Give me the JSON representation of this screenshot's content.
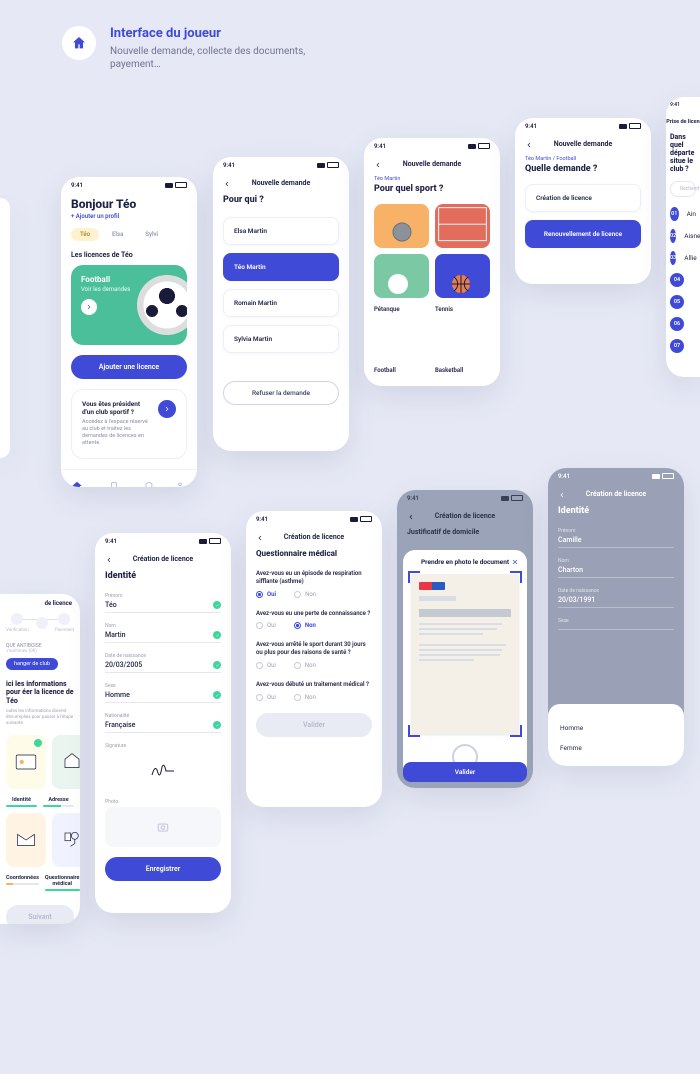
{
  "header": {
    "title": "Interface du joueur",
    "subtitle": "Nouvelle demande, collecte des documents, payement…"
  },
  "status_time": "9:41",
  "p1_home": {
    "greeting": "Bonjour Téo",
    "add_profile": "+ Ajouter un profil",
    "tabs": [
      "Téo",
      "Elsa",
      "Sylvi"
    ],
    "section": "Les licences de Téo",
    "card_sport": "Football",
    "card_view": "Voir les demandes",
    "cta": "Ajouter une licence",
    "president_title": "Vous êtes président d'un club sportif ?",
    "president_body": "Accédez à l'espace réservé au club et traitez les demandes de licences en attente.",
    "nav": [
      "Accueil",
      "Documents",
      "Club",
      "Compte"
    ]
  },
  "p2_who": {
    "title": "Nouvelle demande",
    "q": "Pour qui ?",
    "names": [
      "Elsa Martin",
      "Téo Martin",
      "Romain Martin",
      "Sylvia Martin"
    ],
    "refuse": "Refuser la demande"
  },
  "p3_sport": {
    "title": "Nouvelle demande",
    "crumb": "Téo Martin",
    "q": "Pour quel sport ?",
    "sports": [
      "Pétanque",
      "Tennis",
      "Football",
      "Basketball"
    ]
  },
  "p4_type": {
    "title": "Nouvelle demande",
    "crumb": "Téo Martin / Football",
    "q": "Quelle demande ?",
    "opt1": "Création de licence",
    "opt2": "Renouvellement de licence"
  },
  "p5_dep": {
    "title": "Prise de licen",
    "q": "Dans quel départe\nsitue le club ?",
    "search": "Rechercher",
    "deps": [
      {
        "n": "01",
        "name": "Ain"
      },
      {
        "n": "02",
        "name": "Aisne"
      },
      {
        "n": "03",
        "name": "Allie"
      },
      {
        "n": "04",
        "name": ""
      },
      {
        "n": "05",
        "name": ""
      },
      {
        "n": "06",
        "name": ""
      },
      {
        "n": "07",
        "name": ""
      }
    ]
  },
  "p6_lic": {
    "title": "de licence",
    "stepper": [
      "Vérification",
      "",
      "Paiement"
    ],
    "club": "QUE ANTIBOISE",
    "club2": "-maritimes (06)",
    "change": "hanger de club",
    "headline": "ici les informations pour éer la licence de Téo",
    "sub": "outes les informations doivent être emplies pour passer à l'étape suivante",
    "cards": [
      "Identité",
      "Adresse",
      "Coordonnées",
      "Questionnaire médical"
    ],
    "counts": [
      "7/7",
      "4/7",
      "",
      "3/3"
    ],
    "next": "Suivant"
  },
  "p7_id": {
    "title": "Création de licence",
    "h": "Identité",
    "fields": {
      "prenom_l": "Prénom",
      "prenom": "Téo",
      "nom_l": "Nom",
      "nom": "Martin",
      "dob_l": "Date de naissance",
      "dob": "20/03/2005",
      "sexe_l": "Sexe",
      "sexe": "Homme",
      "nat_l": "Nationalité",
      "nat": "Française",
      "sig_l": "Signature",
      "photo_l": "Photo"
    },
    "save": "Enregistrer"
  },
  "p8_q": {
    "title": "Création de licence",
    "h": "Questionnaire médical",
    "q1": "Avez-vous eu un épisode de respiration sifflante (asthme)",
    "q2": "Avez-vous eu une perte de connaissance ?",
    "q3": "Avez-vous arrêté le sport durant 30 jours ou plus pour des raisons de santé ?",
    "q4": "Avez-vous débuté un traitement médical ?",
    "oui": "Oui",
    "non": "Non",
    "validate": "Valider"
  },
  "p9_scan": {
    "title": "Création de licence",
    "sub": "Justificatif de domicile",
    "sheet": "Prendre en photo le document",
    "validate": "Valider"
  },
  "p10_id2": {
    "title": "Création de licence",
    "h": "Identité",
    "fields": {
      "prenom_l": "Prénom",
      "prenom": "Camille",
      "nom_l": "Nom",
      "nom": "Charton",
      "dob_l": "Date de naissance",
      "dob": "20/03/1991",
      "sexe_l": "Sexe"
    },
    "genders": [
      "Homme",
      "Femme"
    ]
  }
}
